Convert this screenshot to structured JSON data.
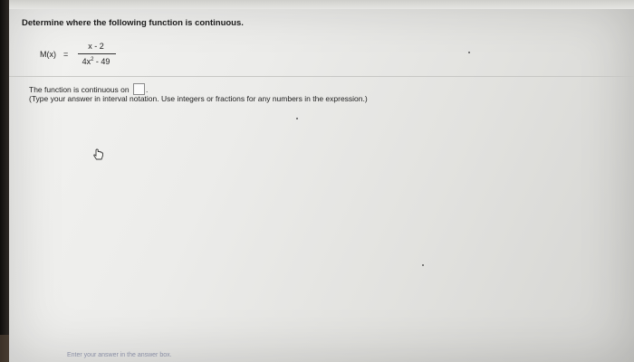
{
  "question": {
    "prompt": "Determine where the following function is continuous.",
    "function_name": "M(x)",
    "equals_sign": "=",
    "numerator": "x - 2",
    "denominator_base": "4x",
    "denominator_exponent": "2",
    "denominator_rest": " - 49"
  },
  "answer": {
    "label": "The function is continuous on",
    "value": "",
    "trailing": ".",
    "instructions": "(Type your answer in interval notation. Use integers or fractions for any numbers in the expression.)"
  },
  "footer": {
    "hint": "Enter your answer in the answer box."
  },
  "icons": {
    "cursor": "hand-pointer-icon"
  },
  "colors": {
    "screen_background": "#ececea",
    "text": "#222222",
    "footer_hint": "#8a8fa5"
  }
}
